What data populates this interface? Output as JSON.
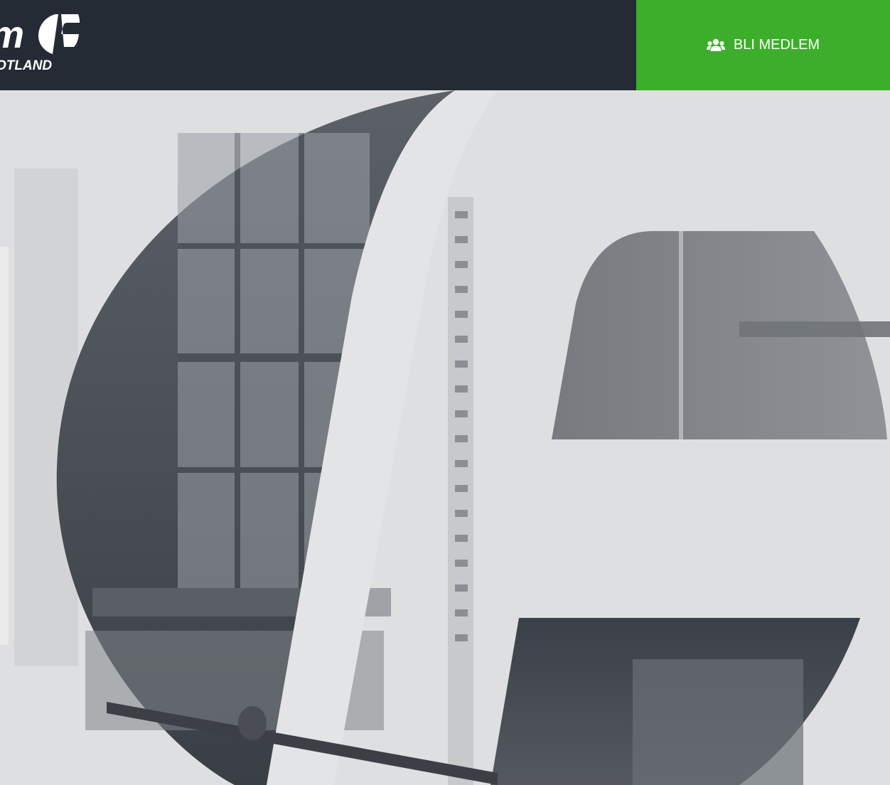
{
  "header": {
    "logo_text": "m",
    "logo_subtext": "OTLAND",
    "cta_label": "BLI MEDLEM",
    "cta_icon": "users-icon"
  },
  "colors": {
    "header_bg": "#252b35",
    "cta_bg": "#3dae2b",
    "hero_bg": "#dfe0e1"
  }
}
